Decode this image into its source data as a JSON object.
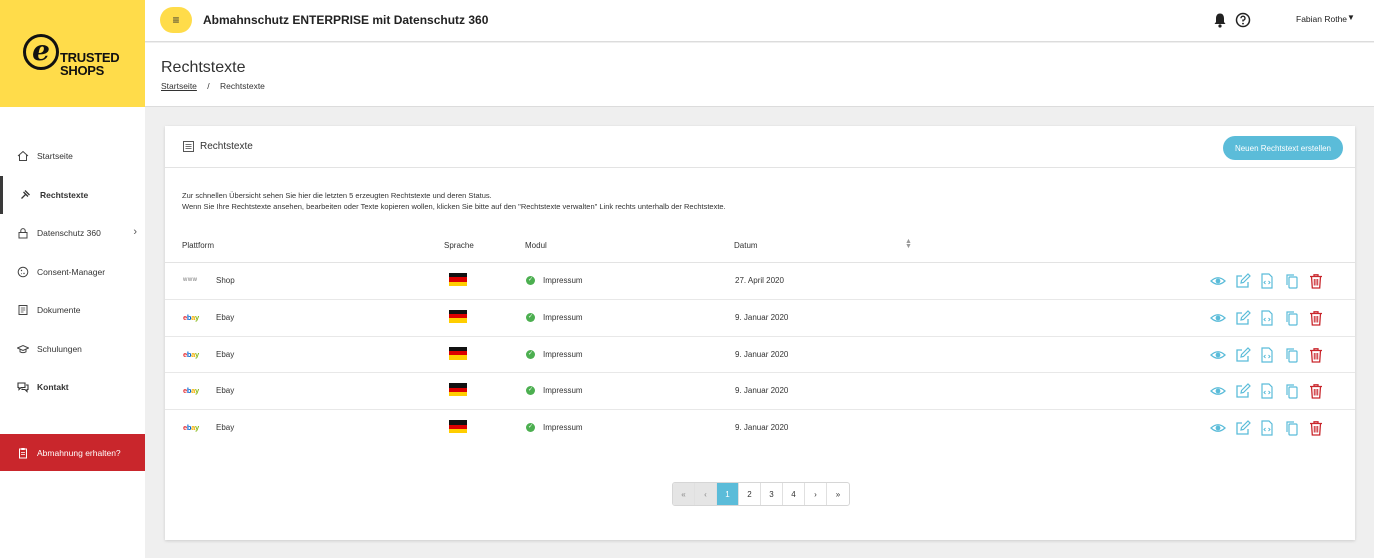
{
  "brand": {
    "logo_letter": "e",
    "logo_line1": "TRUSTED",
    "logo_line2": "SHOPS"
  },
  "header": {
    "menu_icon": "≡",
    "title": "Abmahnschutz ENTERPRISE mit Datenschutz 360",
    "user_name": "Fabian Rothe",
    "user_caret": "▼"
  },
  "page": {
    "title": "Rechtstexte",
    "breadcrumb": {
      "home": "Startseite",
      "separator": "/",
      "current": "Rechtstexte"
    }
  },
  "sidebar": {
    "items": [
      {
        "label": "Startseite",
        "icon": "home-icon"
      },
      {
        "label": "Rechtstexte",
        "icon": "gavel-icon",
        "active": true
      },
      {
        "label": "Datenschutz 360",
        "icon": "lock-icon",
        "chevron": "›"
      },
      {
        "label": "Consent-Manager",
        "icon": "cookie-icon"
      },
      {
        "label": "Dokumente",
        "icon": "document-icon"
      },
      {
        "label": "Schulungen",
        "icon": "graduation-cap-icon"
      },
      {
        "label": "Kontakt",
        "icon": "chat-icon"
      }
    ],
    "alert_button": "Abmahnung erhalten?"
  },
  "card": {
    "title": "Rechtstexte",
    "new_button": "Neuen Rechtstext erstellen",
    "intro_line1": "Zur schnellen Übersicht sehen Sie hier die letzten 5 erzeugten Rechtstexte und deren Status.",
    "intro_line2": "Wenn Sie Ihre Rechtstexte ansehen, bearbeiten oder Texte kopieren wollen, klicken Sie bitte auf den \"Rechtstexte verwalten\" Link rechts unterhalb der Rechtstexte."
  },
  "table": {
    "columns": {
      "platform": "Plattform",
      "language": "Sprache",
      "module": "Modul",
      "date": "Datum"
    },
    "rows": [
      {
        "platform_logo": "www",
        "platform": "Shop",
        "module": "Impressum",
        "date": "27. April 2020"
      },
      {
        "platform_logo": "ebay",
        "platform": "Ebay",
        "module": "Impressum",
        "date": "9. Januar 2020"
      },
      {
        "platform_logo": "ebay",
        "platform": "Ebay",
        "module": "Impressum",
        "date": "9. Januar 2020"
      },
      {
        "platform_logo": "ebay",
        "platform": "Ebay",
        "module": "Impressum",
        "date": "9. Januar 2020"
      },
      {
        "platform_logo": "ebay",
        "platform": "Ebay",
        "module": "Impressum",
        "date": "9. Januar 2020"
      }
    ]
  },
  "pagination": {
    "first": "«",
    "prev": "‹",
    "pages": [
      "1",
      "2",
      "3",
      "4"
    ],
    "next": "›",
    "last": "»"
  },
  "colors": {
    "brand_yellow": "#ffdc4a",
    "accent_blue": "#5bbcd9",
    "danger_red": "#c9262c",
    "success_green": "#4caf50"
  }
}
